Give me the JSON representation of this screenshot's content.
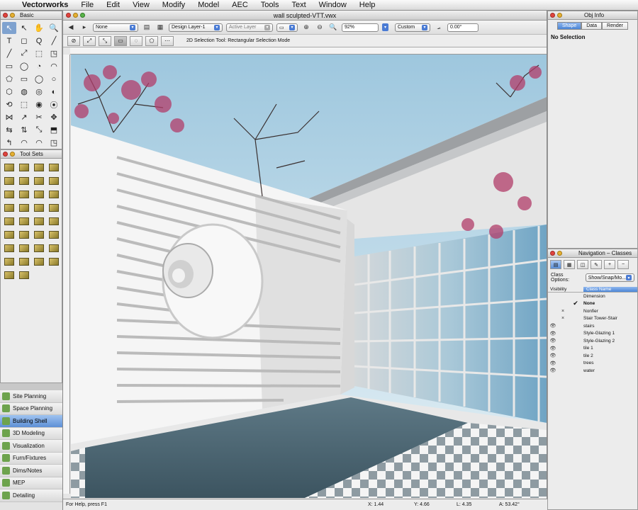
{
  "menubar": {
    "items": [
      "Vectorworks",
      "File",
      "Edit",
      "View",
      "Modify",
      "Model",
      "AEC",
      "Tools",
      "Text",
      "Window",
      "Help"
    ]
  },
  "basic_palette": {
    "title": "Basic",
    "tools": [
      "↖",
      "↖",
      "✋",
      "🔍",
      "T",
      "◻",
      "Q",
      "╱",
      "╱",
      "⤢",
      "⬚",
      "◳",
      "▭",
      "◯",
      "◔",
      "◠",
      "⬠",
      "▭",
      "◯",
      "○",
      "⬡",
      "◍",
      "◎",
      "◐",
      "⟲",
      "⬚",
      "◉",
      "⦿",
      "⋈",
      "↗",
      "✂",
      "✥",
      "⇆",
      "⇅",
      "⤡",
      "⬒",
      "↰",
      "◠",
      "◠",
      "◳"
    ]
  },
  "toolsets_palette": {
    "title": "Tool Sets",
    "count": 34
  },
  "workspaces": [
    {
      "label": "Site Planning",
      "selected": false
    },
    {
      "label": "Space Planning",
      "selected": false
    },
    {
      "label": "Building Shell",
      "selected": true
    },
    {
      "label": "3D Modeling",
      "selected": false
    },
    {
      "label": "Visualization",
      "selected": false
    },
    {
      "label": "Furn/Fixtures",
      "selected": false
    },
    {
      "label": "Dims/Notes",
      "selected": false
    },
    {
      "label": "MEP",
      "selected": false
    },
    {
      "label": "Detailing",
      "selected": false
    }
  ],
  "document": {
    "title": "wall sculpted-VTT.vwx",
    "view_class": "None",
    "design_layer": "Design Layer-1",
    "active_layer": "Active Layer",
    "zoom": "92%",
    "view": "Custom",
    "angle": "0.00°",
    "mode_text": "2D Selection Tool: Rectangular Selection Mode",
    "status_help": "For Help, press F1",
    "coords": [
      "X: 1.44",
      "Y: 4.66",
      "L: 4.35",
      "A: 53.42°"
    ]
  },
  "obj_info": {
    "title": "Obj Info",
    "tabs": [
      "Shape",
      "Data",
      "Render"
    ],
    "selection": "No Selection"
  },
  "navigation": {
    "title": "Navigation – Classes",
    "class_options_label": "Class Options:",
    "class_options_value": "Show/Snap/Mo...",
    "col_visibility": "Visibility",
    "col_class_name": "Class Name",
    "classes": [
      {
        "name": "Dimension",
        "v1": "",
        "v2": "",
        "active": false
      },
      {
        "name": "None",
        "v1": "",
        "v2": "",
        "active": true
      },
      {
        "name": "Nonfier",
        "v1": "",
        "v2": "×",
        "active": false
      },
      {
        "name": "Stair Tower-Stair",
        "v1": "",
        "v2": "×",
        "active": false
      },
      {
        "name": "stairs",
        "v1": "👁",
        "v2": "",
        "active": false
      },
      {
        "name": "Style-Glazing 1",
        "v1": "👁",
        "v2": "",
        "active": false
      },
      {
        "name": "Style-Glazing 2",
        "v1": "👁",
        "v2": "",
        "active": false
      },
      {
        "name": "tile 1",
        "v1": "👁",
        "v2": "",
        "active": false
      },
      {
        "name": "tile 2",
        "v1": "👁",
        "v2": "",
        "active": false
      },
      {
        "name": "trees",
        "v1": "👁",
        "v2": "",
        "active": false
      },
      {
        "name": "water",
        "v1": "👁",
        "v2": "",
        "active": false
      }
    ]
  },
  "colors": {
    "sky_top": "#9ec7de",
    "sky_bottom": "#dfeef5",
    "pool": "#4c6673",
    "wall": "#f3f3f3",
    "selection_blue": "#4b86d6"
  }
}
